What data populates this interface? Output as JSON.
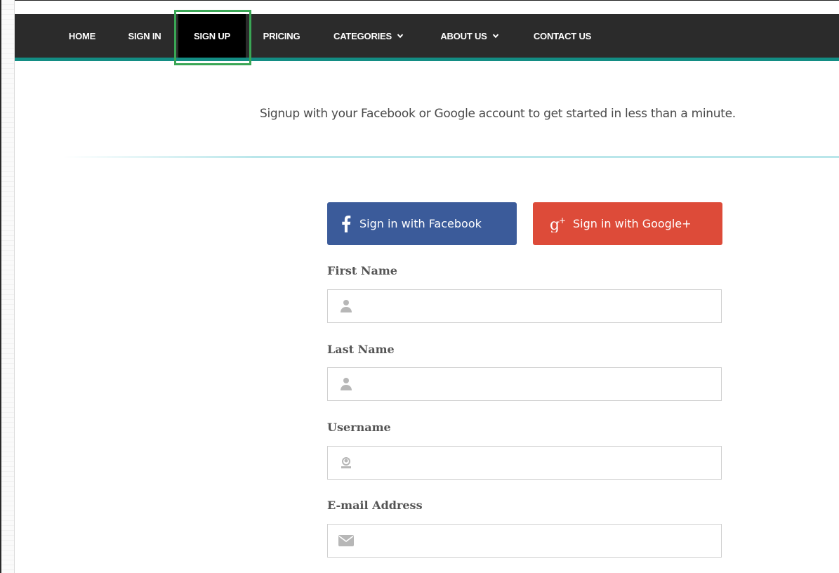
{
  "nav": {
    "items": [
      {
        "label": "HOME"
      },
      {
        "label": "SIGN IN"
      },
      {
        "label": "SIGN UP",
        "active": true
      },
      {
        "label": "PRICING"
      },
      {
        "label": "CATEGORIES",
        "dropdown": true
      },
      {
        "label": "ABOUT US",
        "dropdown": true
      },
      {
        "label": "CONTACT US"
      }
    ]
  },
  "intro": {
    "text": "Signup with your Facebook or Google account to get started in less than a minute."
  },
  "social": {
    "facebook_label": "Sign in with Facebook",
    "google_label": "Sign in with Google+",
    "facebook_icon": "facebook-f-icon",
    "google_icon": "google-plus-icon"
  },
  "form": {
    "first_name": {
      "label": "First Name",
      "value": "",
      "icon": "user-icon"
    },
    "last_name": {
      "label": "Last Name",
      "value": "",
      "icon": "user-icon"
    },
    "username": {
      "label": "Username",
      "value": "",
      "icon": "user-circle-icon"
    },
    "email": {
      "label": "E-mail Address",
      "value": "",
      "icon": "envelope-icon"
    }
  },
  "colors": {
    "navbar": "#2b2b2b",
    "navbar_accent": "#138d84",
    "active_tab": "#000000",
    "highlight": "#3aa655",
    "facebook": "#3b5b9a",
    "google": "#dd4b39"
  }
}
